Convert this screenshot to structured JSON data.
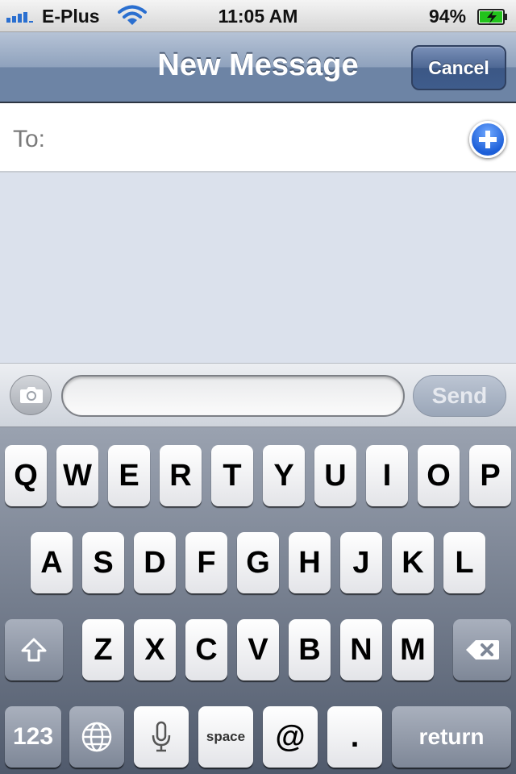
{
  "status_bar": {
    "carrier": "E-Plus",
    "time": "11:05 AM",
    "battery_percent": "94%",
    "signal_bars": 4,
    "battery_level": 0.94
  },
  "nav": {
    "title": "New Message",
    "cancel_label": "Cancel"
  },
  "to_field": {
    "label": "To:",
    "value": ""
  },
  "compose": {
    "input_value": "",
    "send_label": "Send"
  },
  "keyboard": {
    "row1": [
      "Q",
      "W",
      "E",
      "R",
      "T",
      "Y",
      "U",
      "I",
      "O",
      "P"
    ],
    "row2": [
      "A",
      "S",
      "D",
      "F",
      "G",
      "H",
      "J",
      "K",
      "L"
    ],
    "row3": [
      "Z",
      "X",
      "C",
      "V",
      "B",
      "N",
      "M"
    ],
    "numbers_label": "123",
    "space_label": "space",
    "at_label": "@",
    "period_label": ".",
    "return_label": "return"
  },
  "icons": {
    "wifi": "wifi-icon",
    "battery": "battery-icon",
    "add_contact": "plus-circle-icon",
    "camera": "camera-icon",
    "shift": "shift-arrow-icon",
    "delete": "backspace-icon",
    "globe": "globe-icon",
    "microphone": "microphone-icon"
  },
  "colors": {
    "nav_bar": "#6d84a5",
    "add_button": "#1d5fd8",
    "signal": "#2a6fd0",
    "battery_fill": "#22c31c"
  }
}
